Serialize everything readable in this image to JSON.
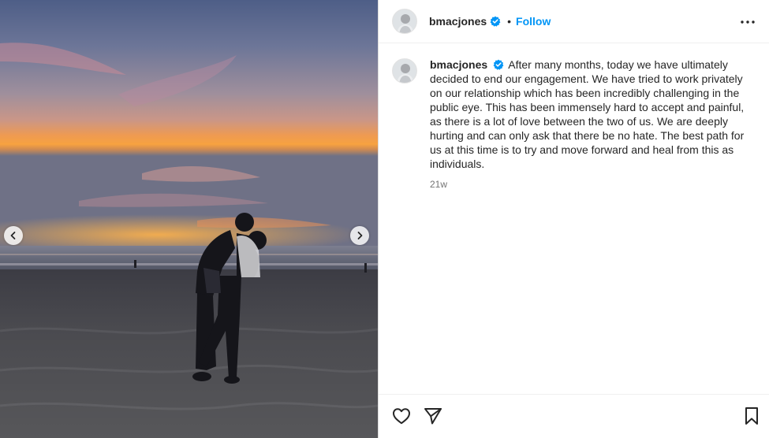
{
  "post": {
    "media": {
      "prev_icon": "chevron-left-icon",
      "next_icon": "chevron-right-icon"
    },
    "header": {
      "username": "bmacjones",
      "verified_icon": "verified-badge-icon",
      "separator": "•",
      "follow_label": "Follow",
      "more_icon": "more-options-icon"
    },
    "caption": {
      "username": "bmacjones",
      "text": "After many months, today we have ultimately decided to end our engagement. We have tried to work privately on our relationship which has been incredibly challenging in the public eye. This has been immensely hard to accept and painful, as there is a lot of love between the two of us. We are deeply hurting and can only ask that there be no hate. The best path for us at this time is to try and move forward and heal from this as individuals.",
      "timestamp": "21w"
    },
    "actions": {
      "like_icon": "heart-icon",
      "share_icon": "paper-plane-icon",
      "save_icon": "bookmark-icon"
    },
    "colors": {
      "accent": "#0095f6",
      "text": "#262626",
      "muted": "#737373",
      "verified": "#0095f6"
    }
  }
}
